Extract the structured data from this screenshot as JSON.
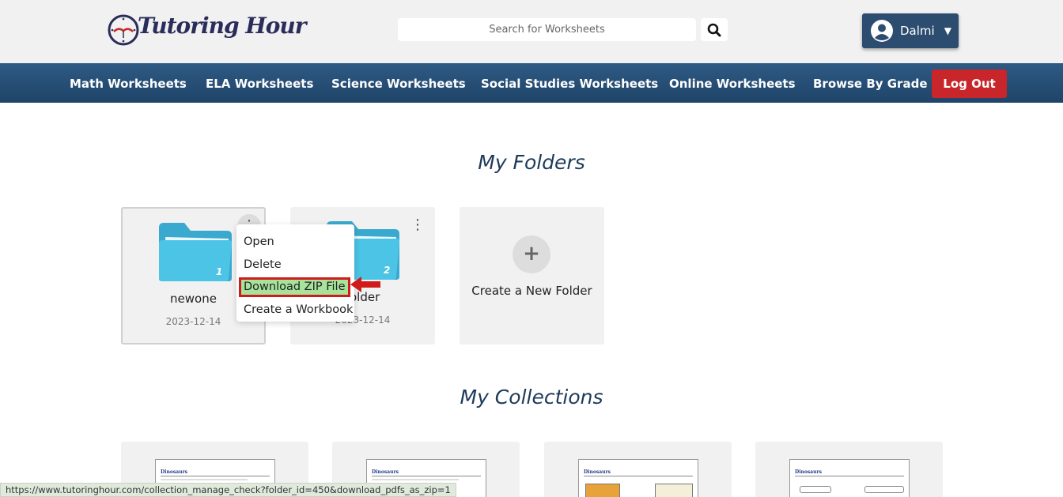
{
  "header": {
    "logo_text": "Tutoring Hour",
    "search_placeholder": "Search for Worksheets",
    "user_name": "Dalmi",
    "user_caret": "▼"
  },
  "nav": {
    "items": [
      {
        "label": "Math Worksheets"
      },
      {
        "label": "ELA Worksheets"
      },
      {
        "label": "Science Worksheets"
      },
      {
        "label": "Social Studies Worksheets"
      },
      {
        "label": "Online Worksheets"
      },
      {
        "label": "Browse By Grade"
      }
    ],
    "logout_label": "Log Out"
  },
  "folders_section": {
    "title": "My Folders",
    "folders": [
      {
        "name": "newone",
        "date": "2023-12-14",
        "count": "1"
      },
      {
        "name": "folder",
        "date": "2023-12-14",
        "count": "2"
      }
    ],
    "create_label": "Create a New Folder",
    "create_plus": "+"
  },
  "context_menu": {
    "items": [
      {
        "label": "Open"
      },
      {
        "label": "Delete"
      },
      {
        "label": "Download ZIP File"
      },
      {
        "label": "Create a Workbook"
      }
    ]
  },
  "collections_section": {
    "title": "My Collections",
    "items": [
      {
        "thumb_title": "Dinosaurs"
      },
      {
        "thumb_title": "Dinosaurs"
      },
      {
        "thumb_title": "Dinosaurs"
      },
      {
        "thumb_title": "Dinosaurs"
      }
    ]
  },
  "status_bar": {
    "url": "https://www.tutoringhour.com/collection_manage_check?folder_id=450&download_pdfs_as_zip=1"
  },
  "colors": {
    "nav_bg": "#2e5a84",
    "logout_bg": "#c8262a",
    "folder_blue": "#4bc4e6",
    "highlight_green": "#a8e39c",
    "highlight_border": "#d11a1a"
  }
}
